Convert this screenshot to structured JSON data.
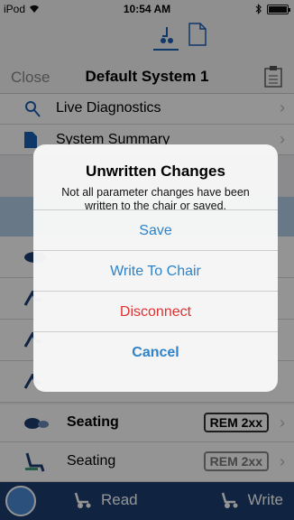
{
  "status_bar": {
    "carrier": "iPod",
    "time": "10:54 AM"
  },
  "nav": {
    "close_label": "Close",
    "title": "Default System 1"
  },
  "list": {
    "items": [
      {
        "label": "Live Diagnostics"
      },
      {
        "label": "System Summary"
      }
    ],
    "seating_rows": [
      {
        "label": "Seating",
        "badge": "REM 2xx"
      },
      {
        "label": "Seating",
        "badge": "REM 2xx"
      }
    ]
  },
  "bottom_bar": {
    "read_label": "Read",
    "write_label": "Write"
  },
  "alert": {
    "title": "Unwritten Changes",
    "message": "Not all parameter changes have been written to the chair or saved.",
    "buttons": [
      "Save",
      "Write To Chair",
      "Disconnect",
      "Cancel"
    ]
  },
  "colors": {
    "accent": "#2e83c8",
    "destructive": "#e03030",
    "bottom_bar": "#1c3f73"
  }
}
